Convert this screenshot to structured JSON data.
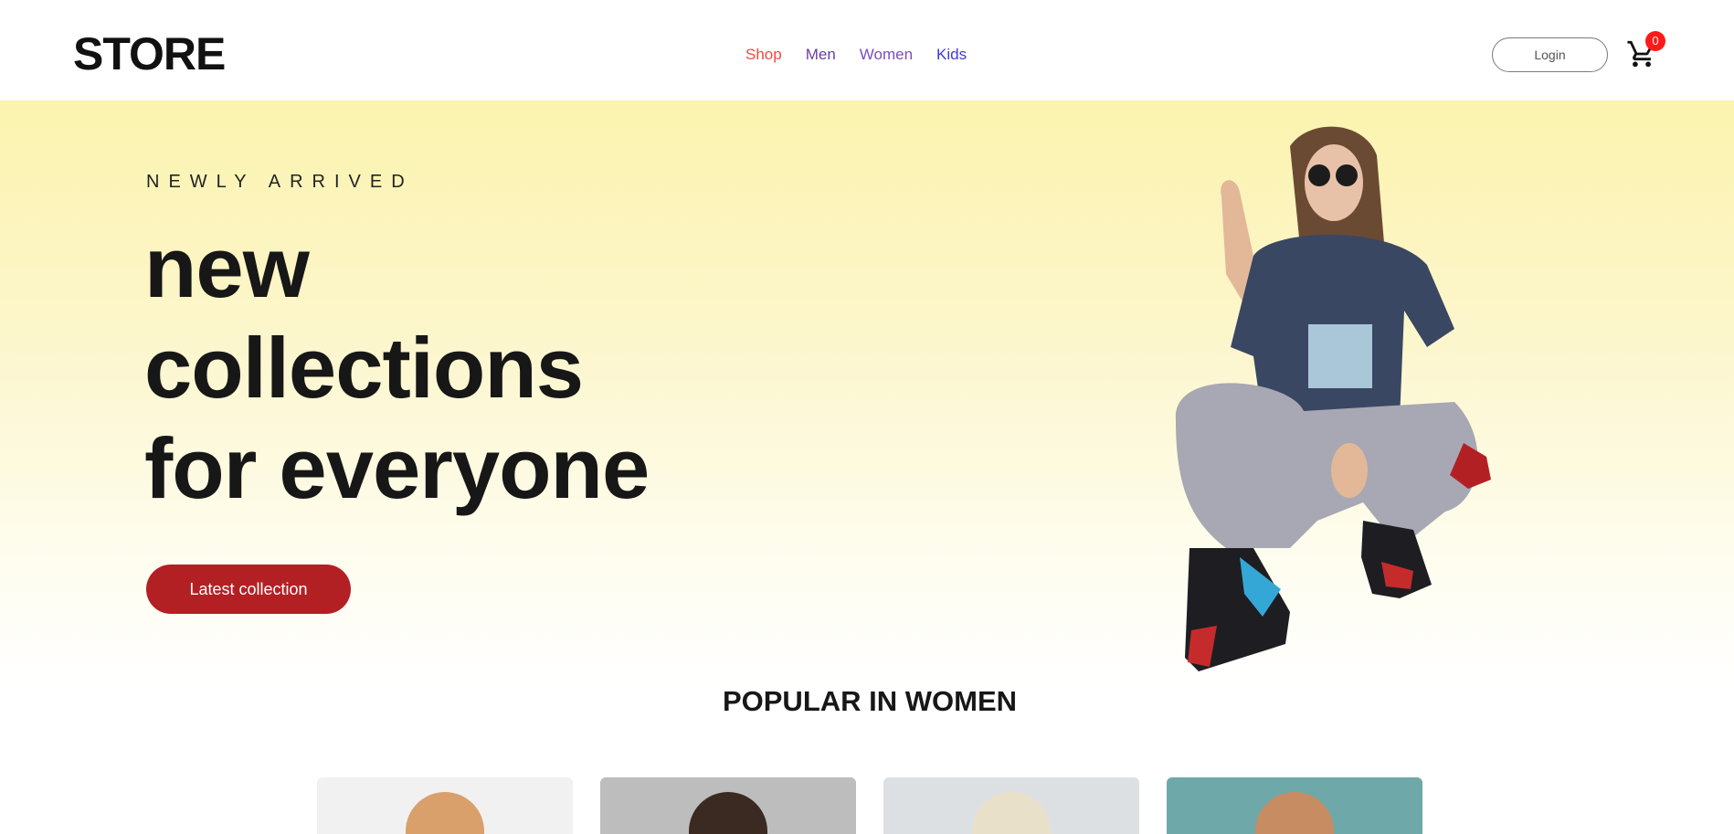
{
  "header": {
    "logo": "STORE",
    "nav": [
      "Shop",
      "Men",
      "Women",
      "Kids"
    ],
    "login_label": "Login",
    "cart_count": "0"
  },
  "hero": {
    "eyebrow": "NEWLY ARRIVED",
    "title_lines": [
      "new",
      "collections",
      "for everyone"
    ],
    "cta_label": "Latest collection"
  },
  "popular": {
    "title": "POPULAR IN WOMEN"
  },
  "colors": {
    "accent": "#b32024",
    "hero_gradient_top": "#fbf3ae",
    "badge": "#ff1a1a"
  },
  "icons": {
    "cart": "shopping-cart-icon"
  }
}
